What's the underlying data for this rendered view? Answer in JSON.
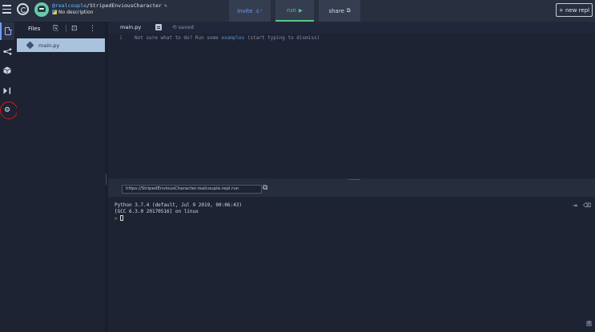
{
  "header": {
    "owner": "@realcouple",
    "separator": "/",
    "repl_name": "StripedEnviousCharacter",
    "description": "No description",
    "invite_label": "invite",
    "run_label": "run",
    "share_label": "share",
    "new_repl_label": "+ new repl"
  },
  "rail": {
    "items": [
      "files-icon",
      "share-icon",
      "packages-icon",
      "console-icon",
      "gear-icon"
    ]
  },
  "files": {
    "title": "Files",
    "items": [
      "main.py"
    ]
  },
  "editor": {
    "tab_label": "main.py",
    "saved_label": "saved",
    "line_number": "1",
    "hint_before": "Not sure what to do? Run some ",
    "hint_link": "examples",
    "hint_after": " (start typing to dismiss)"
  },
  "console": {
    "url": "https://StripedEnviousCharacter.realcouple.repl.run",
    "lines": [
      "Python 3.7.4 (default, Jul  9 2019, 00:06:43)",
      "[GCC 6.3.0 20170516] on linux"
    ],
    "prompt": ">",
    "help": "?"
  },
  "colors": {
    "accent_blue": "#6f9dff",
    "run_green": "#58c984",
    "prompt_orange": "#e38a2c",
    "annotation_red": "#d01919",
    "background": "#1d2333"
  }
}
